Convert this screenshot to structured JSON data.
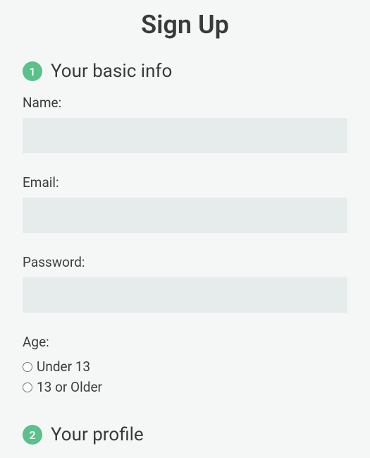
{
  "title": "Sign Up",
  "sections": [
    {
      "num": "1",
      "title": "Your basic info"
    },
    {
      "num": "2",
      "title": "Your profile"
    }
  ],
  "fields": {
    "name": {
      "label": "Name:",
      "value": ""
    },
    "email": {
      "label": "Email:",
      "value": ""
    },
    "password": {
      "label": "Password:",
      "value": ""
    },
    "age": {
      "label": "Age:",
      "options": [
        {
          "label": "Under 13"
        },
        {
          "label": "13 or Older"
        }
      ]
    }
  }
}
